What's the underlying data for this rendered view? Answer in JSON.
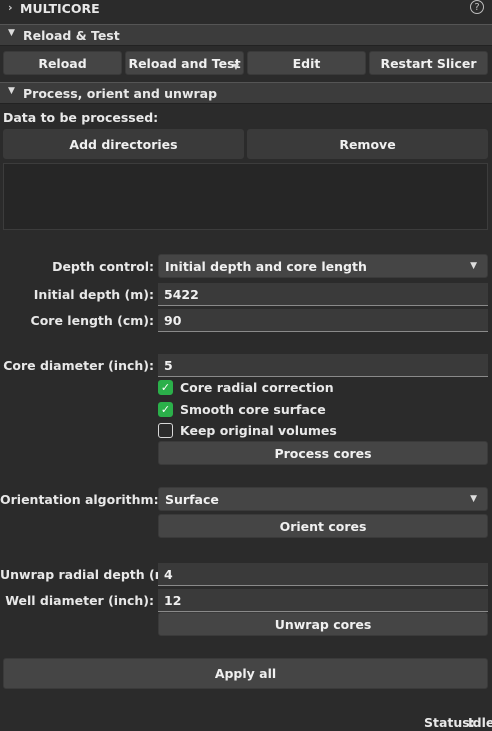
{
  "header": {
    "title": "MULTICORE",
    "collapse_glyph": "›",
    "help_glyph": "?"
  },
  "reload_section": {
    "title": "Reload & Test",
    "buttons": {
      "reload": "Reload",
      "reload_test": "Reload and Test",
      "edit": "Edit",
      "restart": "Restart Slicer"
    }
  },
  "process_section": {
    "title": "Process, orient and unwrap",
    "data_label": "Data to be processed:",
    "add_directories": "Add directories",
    "remove": "Remove",
    "depth_control_label": "Depth control:",
    "depth_control_value": "Initial depth and core length",
    "initial_depth_label": "Initial depth (m):",
    "initial_depth_value": "5422",
    "core_length_label": "Core length (cm):",
    "core_length_value": "90",
    "core_diameter_label": "Core diameter (inch):",
    "core_diameter_value": "5",
    "checkboxes": [
      {
        "label": "Core radial correction",
        "checked": true
      },
      {
        "label": "Smooth core surface",
        "checked": true
      },
      {
        "label": "Keep original volumes",
        "checked": false
      }
    ],
    "process_cores": "Process cores",
    "orientation_label": "Orientation algorithm:",
    "orientation_value": "Surface",
    "orient_cores": "Orient cores",
    "unwrap_depth_label": "Unwrap radial depth (mm):",
    "unwrap_depth_value": "4",
    "well_diameter_label": "Well diameter (inch):",
    "well_diameter_value": "12",
    "unwrap_cores": "Unwrap cores",
    "apply_all": "Apply all"
  },
  "status": {
    "label": "Status:",
    "value": "Idle"
  },
  "colors": {
    "background": "#2b2b2b",
    "button": "#454545",
    "checkbox_checked": "#2bb04a"
  }
}
